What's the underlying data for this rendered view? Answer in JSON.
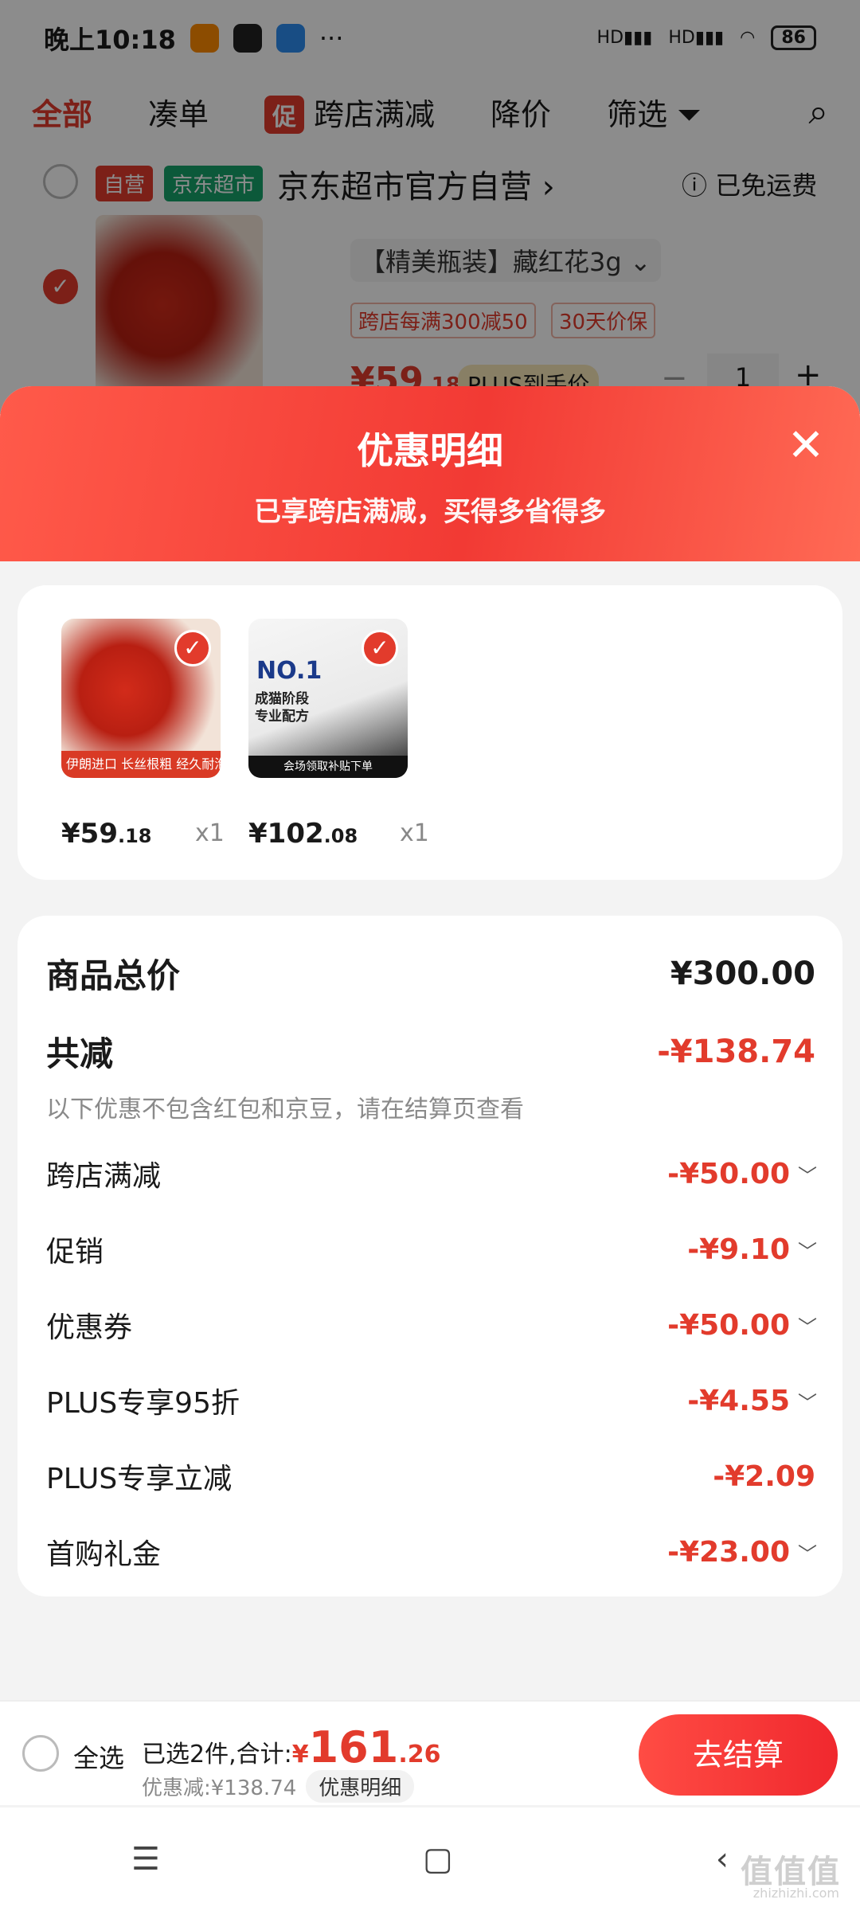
{
  "status_bar": {
    "time": "晚上10:18",
    "more": "···",
    "signal1": "HD",
    "signal2": "HD",
    "battery": "86"
  },
  "tabs": [
    {
      "label": "全部"
    },
    {
      "label": "凑单"
    },
    {
      "label": "跨店满减",
      "tag": "促"
    },
    {
      "label": "降价"
    },
    {
      "label": "筛选"
    }
  ],
  "store": {
    "tag_self": "自营",
    "tag_market": "京东超市",
    "name": "京东超市官方自营",
    "shipping": "已免运费",
    "product_title": "【精美瓶装】藏红花3g",
    "chip1": "跨店每满300减50",
    "chip2": "30天价保",
    "price_int": "¥59",
    "price_dec": ".18",
    "plus_label": "PLUS到手价",
    "qty": "1",
    "img_text1": "伊朗进口",
    "img_text2": "长丝根粗 经久耐泡"
  },
  "sheet": {
    "title": "优惠明细",
    "subtitle": "已享跨店满减，买得多省得多",
    "items": [
      {
        "price_int": "¥59",
        "price_dec": ".18",
        "qty": "x1",
        "img_text1": "伊朗进口",
        "img_text2": "长丝根粗 经久耐泡"
      },
      {
        "price_int": "¥102",
        "price_dec": ".08",
        "qty": "x1",
        "img_text1": "NO.1",
        "img_text2": "成猫阶段 专业配方",
        "img_text3": "会场领取补贴下单"
      }
    ],
    "total_label": "商品总价",
    "total_value": "¥300.00",
    "reduce_label": "共减",
    "reduce_value": "-¥138.74",
    "note": "以下优惠不包含红包和京豆，请在结算页查看",
    "discounts": [
      {
        "label": "跨店满减",
        "value": "-¥50.00",
        "expandable": true
      },
      {
        "label": "促销",
        "value": "-¥9.10",
        "expandable": true
      },
      {
        "label": "优惠券",
        "value": "-¥50.00",
        "expandable": true
      },
      {
        "label": "PLUS专享95折",
        "value": "-¥4.55",
        "expandable": true
      },
      {
        "label": "PLUS专享立减",
        "value": "-¥2.09",
        "expandable": false
      },
      {
        "label": "首购礼金",
        "value": "-¥23.00",
        "expandable": true
      }
    ]
  },
  "bottom_bar": {
    "select_all": "全选",
    "selected_text": "已选2件,合计:",
    "total_currency": "¥",
    "total_int": "161",
    "total_dec": ".26",
    "discount_text": "优惠减:¥138.74",
    "detail_pill": "优惠明细",
    "checkout": "去结算"
  },
  "nav": {
    "menu": "☰",
    "home": "▢",
    "back": "‹"
  },
  "watermark": {
    "main": "值值值",
    "sub": "zhizhizhi.com"
  },
  "colors": {
    "accent": "#e23b2c",
    "green": "#16a36a"
  }
}
